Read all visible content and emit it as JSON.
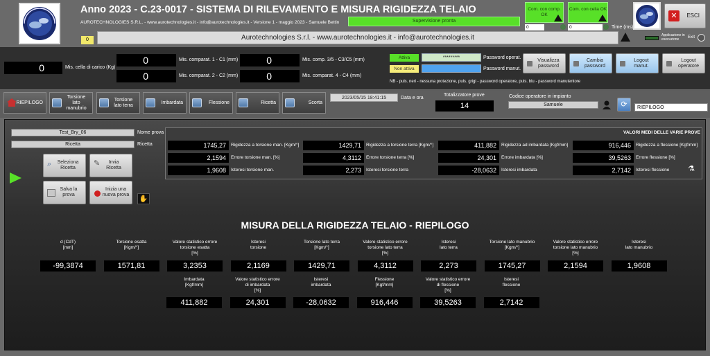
{
  "header": {
    "title": "Anno 2023 - C.23-0017 - SISTEMA DI RILEVAMENTO E MISURA RIGIDEZZA TELAIO",
    "subtitle": "AUROTECHNOLOGIES S.R.L. - www.aurotechnologies.it - info@aurotechnologies.it - Versione 1 - maggio 2023 - Samuele Bettin",
    "banner": "Aurotechnologies S.r.l. - www.aurotechnologies.it - info@aurotechnologies.it",
    "supervision_status": "Supervisione pronta",
    "counter_small": "0",
    "com_comp": "Com. con comp. OK",
    "com_cella": "Com. con cella OK",
    "com_comp_value": "0",
    "com_cella_value": "0",
    "time_label": "Time (ms)",
    "app_running_label": "Applicazione in esecuzione",
    "exit_label": "Exit",
    "esci_label": "ESCI",
    "colors": {
      "accent_green": "#58e028",
      "title_bg": "#6a6a6a",
      "dark_panel": "#2f2f2f",
      "blue_button": "#a8cfee"
    }
  },
  "measures": {
    "cella_label": "Mis. cella di carico (Kg)",
    "cella_value": "0",
    "c1_label": "Mis. comparat. 1 - C1 (mm)",
    "c1_value": "0",
    "c2_label": "Mis. comparat. 2 - C2 (mm)",
    "c2_value": "0",
    "c35_label": "Mis. comp. 3/5 - C3/C5 (mm)",
    "c35_value": "0",
    "c4_label": "Mis. comparat. 4 - C4 (mm)",
    "c4_value": "0"
  },
  "passwords": {
    "attiva": "Attiva",
    "non_attiva": "Non attiva",
    "operator_password_value": "*********",
    "operator_password_label": "Password operat.",
    "manut_password_label": "Password manut.",
    "note": "NB - puls. neri - nessuna protezione, puls. grigi - password operatore, puls. blu - password manutentore",
    "visualizza": "Visualizza password",
    "cambia": "Cambia password",
    "logout_manut": "Logout manut.",
    "logout_operatore": "Logout operatore"
  },
  "tabs": [
    "RIEPILOGO",
    "Torsione lato manubrio",
    "Torsione lato terra",
    "Imbardata",
    "Flessione",
    "Ricetta",
    "Scorta"
  ],
  "status": {
    "datetime": "2023/05/15 18:41:15",
    "datetime_label": "Data e ora",
    "totalizer_label": "Totalizzatore prove",
    "totalizer_value": "14",
    "operator_code_label": "Codice operatore in impianto",
    "operator_value": "Samuele",
    "page_name": "RIEPILOGO"
  },
  "test": {
    "name_value": "Test_Bry_06",
    "name_label": "Nome prova",
    "recipe_value": "Ricetta",
    "recipe_label": "Ricetta",
    "btn_seleziona": "Seleziona Ricetta",
    "btn_invia": "Invia Ricetta",
    "btn_salva": "Salva la prova",
    "btn_inizia": "Inizia una nuova prova"
  },
  "averages": {
    "title": "VALORI MEDI DELLE VARIE PROVE",
    "rows": [
      [
        {
          "value": "1745,27",
          "label": "Rigidezza a torsione man. [Kgm/°]"
        },
        {
          "value": "1429,71",
          "label": "Rigidezza a torsione terra [Kgm/°]"
        },
        {
          "value": "411,882",
          "label": "Rigidezza ad imbardata [Kgf/mm]"
        },
        {
          "value": "916,446",
          "label": "Rigidezza a flessione [Kgf/mm]"
        }
      ],
      [
        {
          "value": "2,1594",
          "label": "Errore torsione man. [%]"
        },
        {
          "value": "4,3112",
          "label": "Errore torsione terra [%]"
        },
        {
          "value": "24,301",
          "label": "Errore imbardata [%]"
        },
        {
          "value": "39,5263",
          "label": "Errore flessione [%]"
        }
      ],
      [
        {
          "value": "1,9608",
          "label": "Isteresi torsione man."
        },
        {
          "value": "2,273",
          "label": "Isteresi torsione terra"
        },
        {
          "value": "-28,0632",
          "label": "Isteresi imbardata"
        },
        {
          "value": "2,7142",
          "label": "Isteresi flessione"
        }
      ]
    ]
  },
  "summary": {
    "title": "MISURA DELLA RIGIDEZZA TELAIO - RIEPILOGO",
    "row1": [
      {
        "label": "d (CdT)\n[mm]",
        "value": "-99,3874"
      },
      {
        "label": "Torsione esatta\n[Kgm/°]",
        "value": "1571,81"
      },
      {
        "label": "Valore statistico errore\ntorsione esatta\n[%]",
        "value": "3,2353"
      },
      {
        "label": "Isteresi\ntorsione",
        "value": "2,1169"
      },
      {
        "label": "Torsione lato terra\n[Kgm/°]",
        "value": "1429,71"
      },
      {
        "label": "Valore statistico errore\ntorsione lato terra\n[%]",
        "value": "4,3112"
      },
      {
        "label": "Isteresi\nlato terra",
        "value": "2,273"
      },
      {
        "label": "Torsione lato manubrio\n[Kgm/°]",
        "value": "1745,27"
      },
      {
        "label": "Valore statistico errore\ntorsione lato manubrio\n[%]",
        "value": "2,1594"
      },
      {
        "label": "Isteresi\nlato manubrio",
        "value": "1,9608"
      }
    ],
    "row2": [
      {
        "label": "Imbardata\n[Kgf/mm]",
        "value": "411,882"
      },
      {
        "label": "Valore statistico errore\ndi imbardata\n[%]",
        "value": "24,301"
      },
      {
        "label": "Isteresi\nimbardata",
        "value": "-28,0632"
      },
      {
        "label": "Flessione\n[Kgf/mm]",
        "value": "916,446"
      },
      {
        "label": "Valore statistico errore\ndi flessione\n[%]",
        "value": "39,5263"
      },
      {
        "label": "Isteresi\nflessione",
        "value": "2,7142"
      }
    ]
  }
}
